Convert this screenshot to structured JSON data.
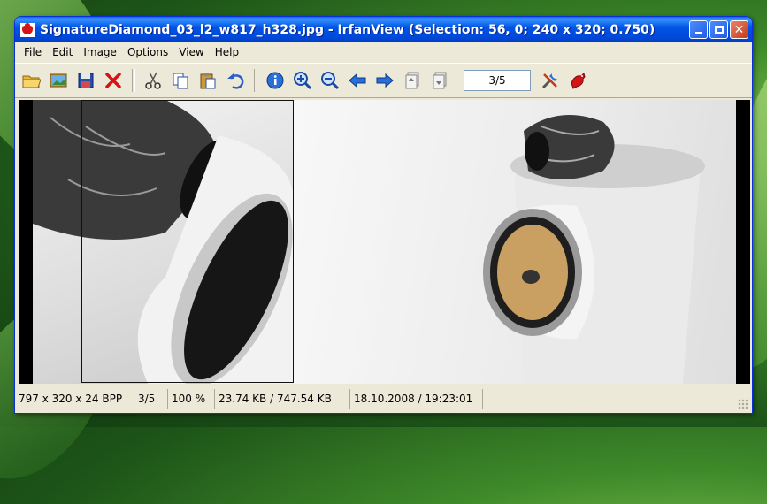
{
  "window": {
    "title": "SignatureDiamond_03_l2_w817_h328.jpg - IrfanView (Selection: 56, 0; 240 x 320; 0.750)"
  },
  "menu": [
    "File",
    "Edit",
    "Image",
    "Options",
    "View",
    "Help"
  ],
  "toolbar": {
    "page_indicator": "3/5",
    "icons": [
      "open-folder-icon",
      "slideshow-icon",
      "save-icon",
      "delete-icon",
      "cut-icon",
      "copy-icon",
      "paste-icon",
      "undo-icon",
      "info-icon",
      "zoom-in-icon",
      "zoom-out-icon",
      "previous-icon",
      "next-icon",
      "first-page-icon",
      "last-page-icon",
      "settings-icon",
      "exit-icon"
    ]
  },
  "status": {
    "dimensions": "797 x 320 x 24 BPP",
    "index": "3/5",
    "zoom": "100 %",
    "size": "23.74 KB / 747.54 KB",
    "datetime": "18.10.2008 / 19:23:01"
  },
  "colors": {
    "titlebar": "#0055e5",
    "window_bg": "#ece9d8"
  }
}
